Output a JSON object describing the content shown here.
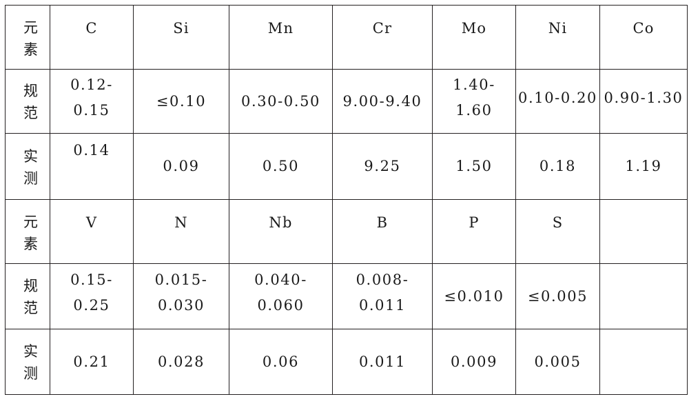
{
  "document": {
    "type": "chemical-composition-table",
    "language": "zh-CN"
  },
  "labels": {
    "element": "元素",
    "element_chars": [
      "元",
      "素"
    ],
    "spec": "规范",
    "spec_chars": [
      "规",
      "范"
    ],
    "measured": "实测",
    "measured_chars": [
      "实",
      "测"
    ]
  },
  "table": {
    "columns": 9,
    "rows": 6,
    "blocks": [
      {
        "id": "block-1",
        "elements": [
          "C",
          "Si",
          "Mn",
          "Cr",
          "Mo",
          "Ni",
          "Co"
        ],
        "spec": [
          "0.12-0.15",
          "≤0.10",
          "0.30-0.50",
          "9.00-9.40",
          "1.40-1.60",
          "0.10-0.20",
          "0.90-1.30"
        ],
        "measured": [
          "0.14",
          "0.09",
          "0.50",
          "9.25",
          "1.50",
          "0.18",
          "1.19"
        ]
      },
      {
        "id": "block-2",
        "elements": [
          "V",
          "N",
          "Nb",
          "B",
          "P",
          "S",
          ""
        ],
        "spec": [
          "0.15-0.25",
          "0.015-0.030",
          "0.040-0.060",
          "0.008-0.011",
          "≤0.010",
          "≤0.005",
          ""
        ],
        "measured": [
          "0.21",
          "0.028",
          "0.06",
          "0.011",
          "0.009",
          "0.005",
          ""
        ]
      }
    ]
  },
  "colors": {
    "border": "#231f20",
    "text": "#1a1a1a",
    "background": "#ffffff"
  }
}
